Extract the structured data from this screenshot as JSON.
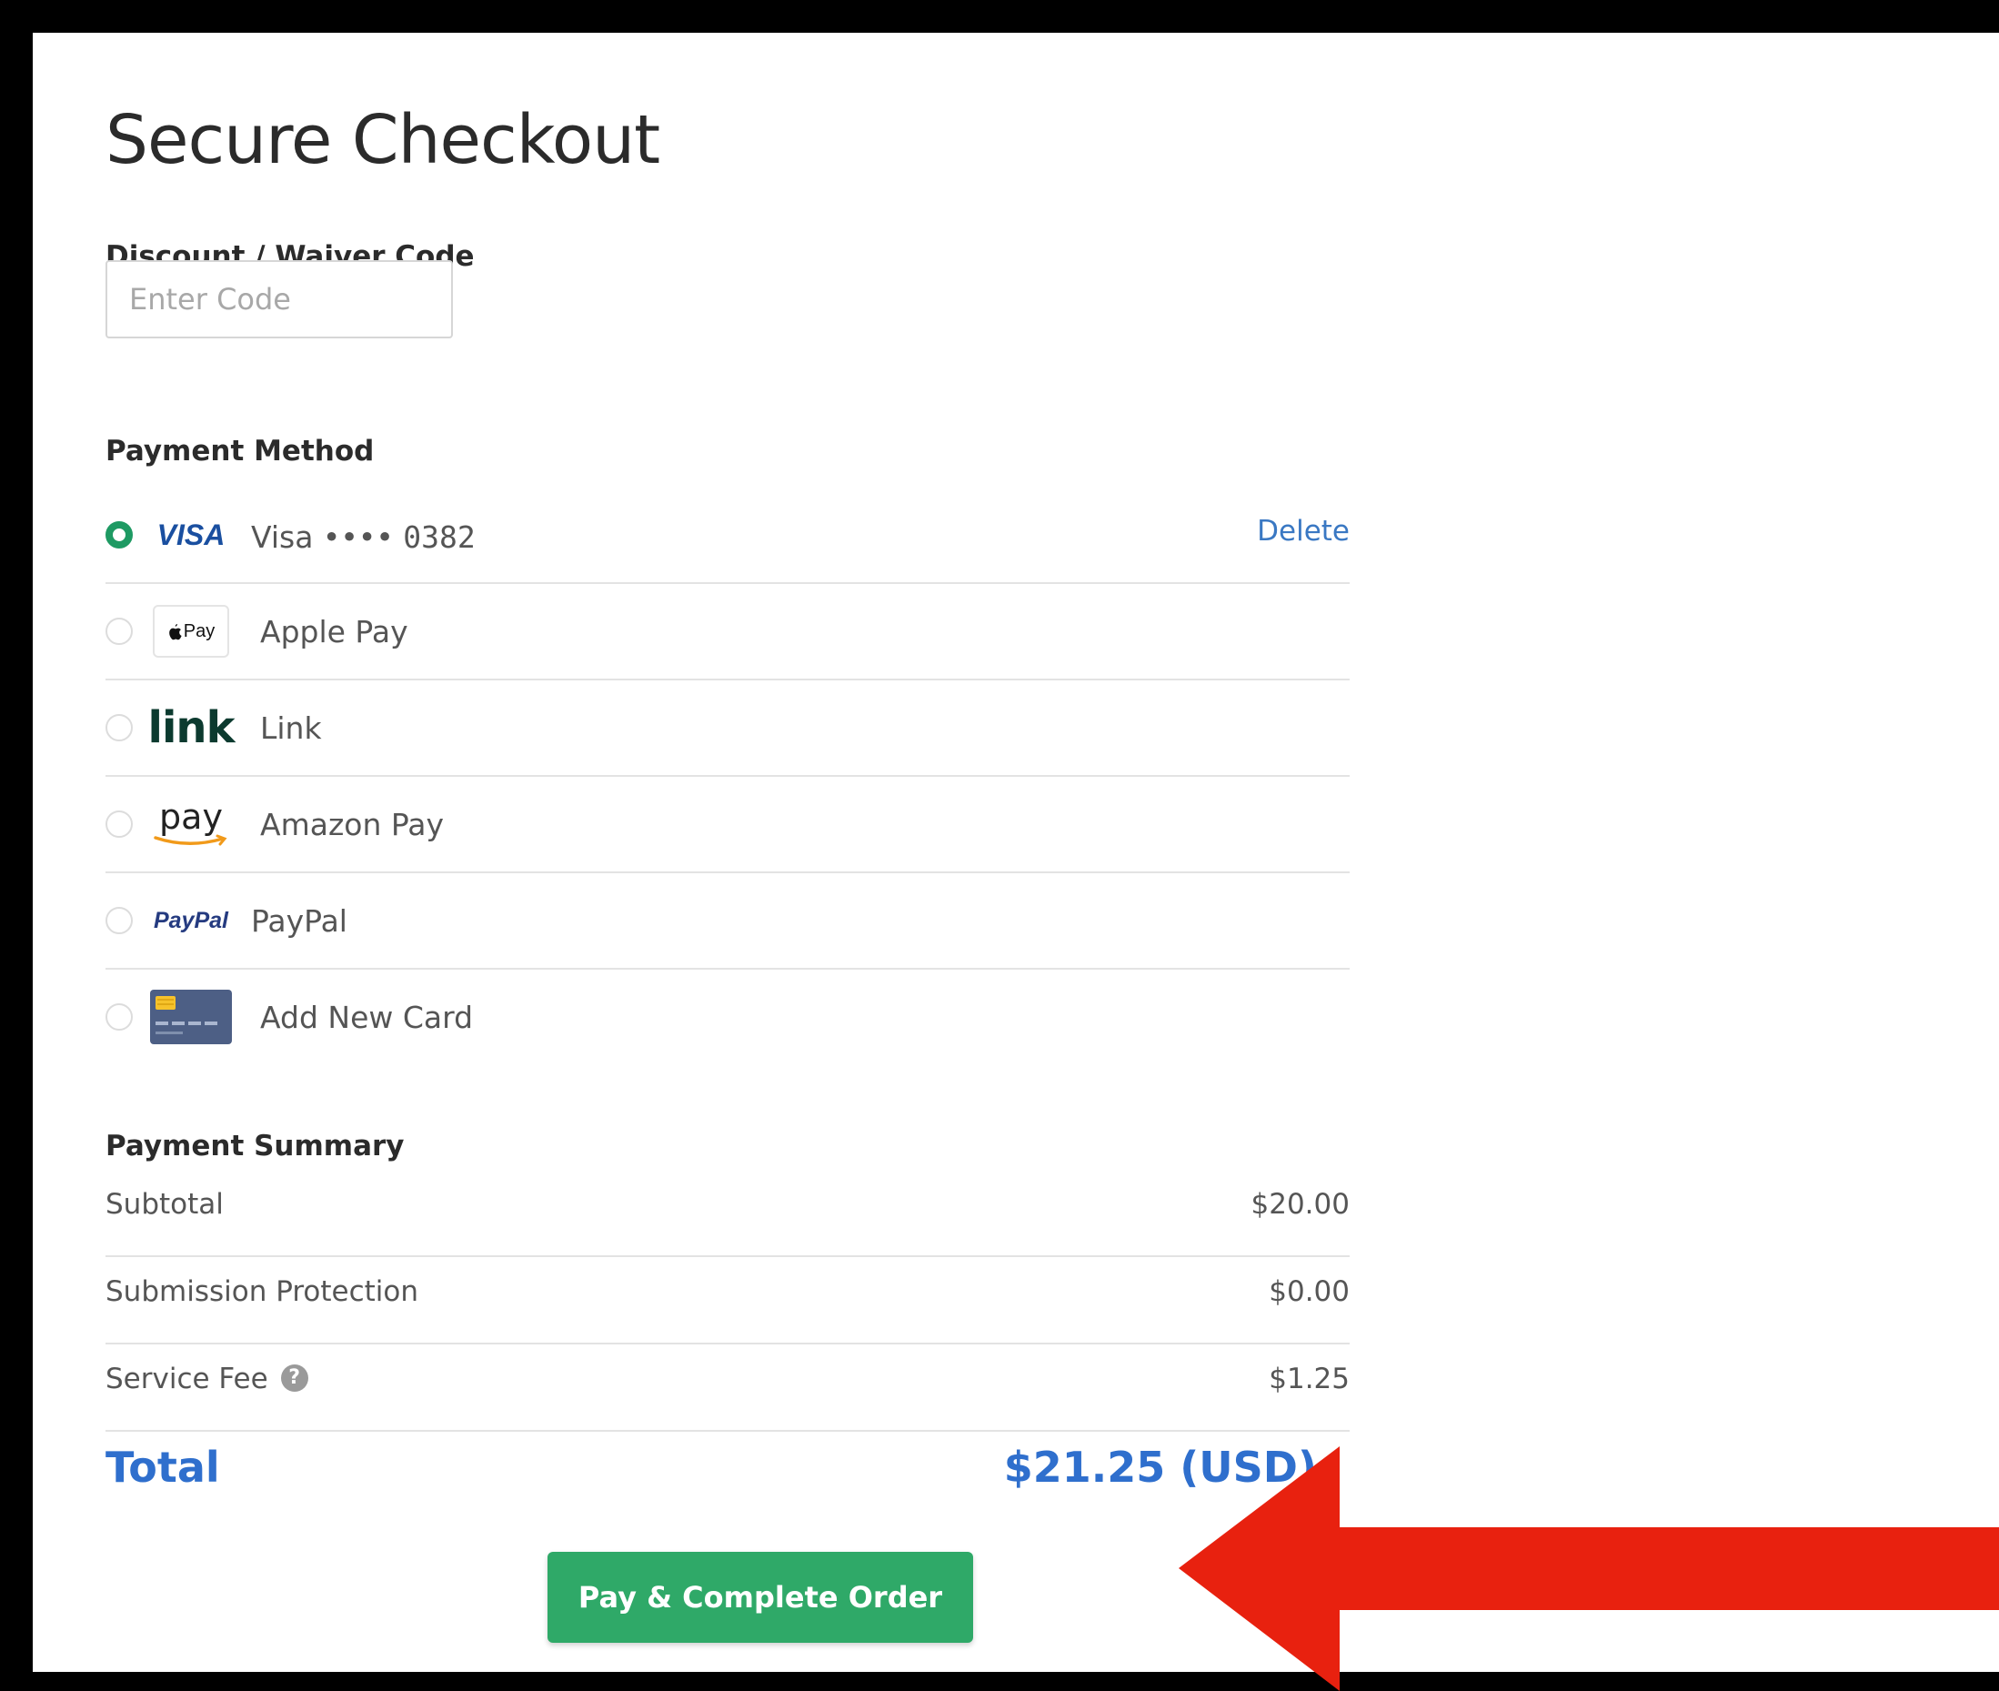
{
  "page": {
    "title": "Secure Checkout"
  },
  "discount": {
    "label": "Discount / Waiver Code",
    "placeholder": "Enter Code",
    "value": ""
  },
  "payment_method": {
    "label": "Payment Method",
    "options": [
      {
        "logo_text": "VISA",
        "label": "Visa ••••",
        "last4": "0382",
        "selected": true,
        "action": "Delete"
      },
      {
        "logo_text": "Pay",
        "label": "Apple Pay",
        "selected": false
      },
      {
        "logo_text": "link",
        "label": "Link",
        "selected": false
      },
      {
        "logo_text": "pay",
        "label": "Amazon Pay",
        "selected": false
      },
      {
        "logo_text": "PayPal",
        "label": "PayPal",
        "selected": false
      },
      {
        "logo_text": "",
        "label": "Add New Card",
        "selected": false
      }
    ]
  },
  "summary": {
    "label": "Payment Summary",
    "rows": [
      {
        "label": "Subtotal",
        "value": "$20.00"
      },
      {
        "label": "Submission Protection",
        "value": "$0.00"
      },
      {
        "label": "Service Fee",
        "value": "$1.25"
      }
    ],
    "total_label": "Total",
    "total_value": "$21.25 (USD)"
  },
  "actions": {
    "pay_label": "Pay & Complete Order"
  },
  "colors": {
    "accent_green": "#2fa968",
    "link_blue": "#3a78c3",
    "total_blue": "#2f6fcd",
    "arrow_red": "#e8210f"
  }
}
